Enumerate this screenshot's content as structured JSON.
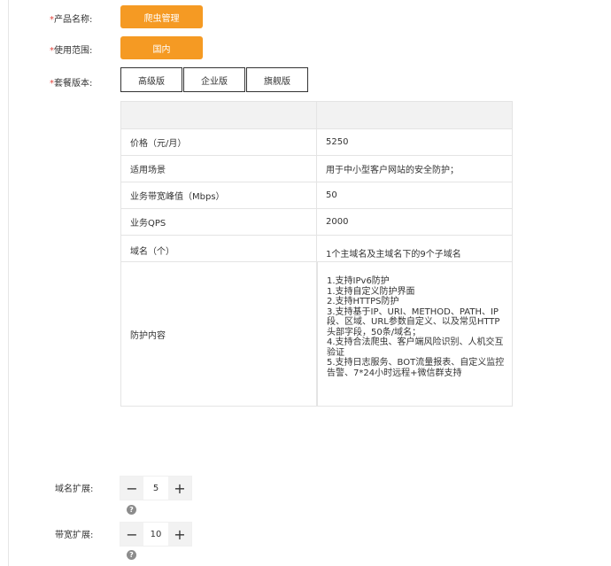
{
  "form": {
    "product_name": {
      "required_mark": "*",
      "label": "产品名称:",
      "value": "爬虫管理"
    },
    "usage_scope": {
      "required_mark": "*",
      "label": "使用范围:",
      "value": "国内"
    },
    "package_version": {
      "required_mark": "*",
      "label": "套餐版本:",
      "options": [
        "高级版",
        "企业版",
        "旗舰版"
      ]
    }
  },
  "spec_table": {
    "header": [
      "",
      ""
    ],
    "rows": [
      {
        "name": "价格（元/月）",
        "value": "5250"
      },
      {
        "name": "适用场景",
        "value": "用于中小型客户网站的安全防护；"
      },
      {
        "name": "业务带宽峰值（Mbps）",
        "value": "50"
      },
      {
        "name": "业务QPS",
        "value": "2000"
      },
      {
        "name": "域名（个）",
        "value": "1个主域名及主域名下的9个子域名"
      }
    ],
    "protection": {
      "name": "防护内容",
      "lines": [
        "1.支持IPv6防护",
        "1.支持自定义防护界面",
        "2.支持HTTPS防护",
        "3.支持基于IP、URI、METHOD、PATH、IP段、区域、URL参数自定义、以及常见HTTP头部字段，50条/域名；",
        "4.支持合法爬虫、客户端风险识别、人机交互验证",
        "5.支持日志服务、BOT流量报表、自定义监控告警、7*24小时远程+微信群支持"
      ]
    }
  },
  "domain_expansion": {
    "label": "域名扩展:",
    "value": "5",
    "minus": "−",
    "plus": "+",
    "help": "?"
  },
  "bandwidth_expansion": {
    "label": "带宽扩展:",
    "value": "10",
    "minus": "−",
    "plus": "+",
    "help": "?"
  }
}
